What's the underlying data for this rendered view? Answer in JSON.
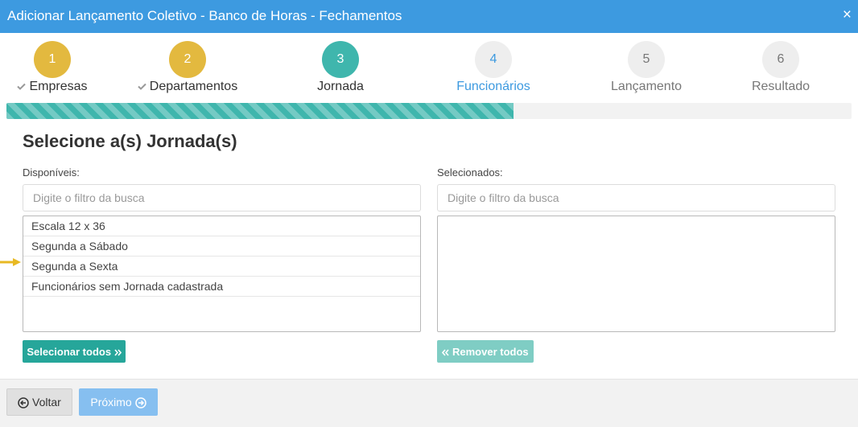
{
  "window": {
    "title": "Adicionar Lançamento Coletivo - Banco de Horas - Fechamentos",
    "close": "×"
  },
  "steps": [
    {
      "number": "1",
      "label": "Empresas",
      "state": "done"
    },
    {
      "number": "2",
      "label": "Departamentos",
      "state": "done"
    },
    {
      "number": "3",
      "label": "Jornada",
      "state": "current"
    },
    {
      "number": "4",
      "label": "Funcionários",
      "state": "next"
    },
    {
      "number": "5",
      "label": "Lançamento",
      "state": "todo"
    },
    {
      "number": "6",
      "label": "Resultado",
      "state": "todo"
    }
  ],
  "progress": {
    "percent": 60
  },
  "heading": "Selecione a(s) Jornada(s)",
  "available": {
    "label": "Disponíveis:",
    "filter_placeholder": "Digite o filtro da busca",
    "filter_value": "",
    "items": [
      "Escala 12 x 36",
      "Segunda a Sábado",
      "Segunda a Sexta",
      "Funcionários sem Jornada cadastrada"
    ],
    "button": "Selecionar todos"
  },
  "selected": {
    "label": "Selecionados:",
    "filter_placeholder": "Digite o filtro da busca",
    "filter_value": "",
    "items": [],
    "button": "Remover todos"
  },
  "footer": {
    "back": "Voltar",
    "next": "Próximo"
  },
  "colors": {
    "header": "#3d9ae0",
    "step_done": "#e3b93f",
    "step_current": "#3fb6ad",
    "add_button": "#26a69a",
    "pointer_arrow": "#e8b923"
  },
  "icons": {
    "step_done": "check-icon",
    "add": "double-chevron-right-icon",
    "remove": "double-chevron-left-icon",
    "back": "circle-arrow-left-icon",
    "next": "circle-arrow-right-icon"
  }
}
